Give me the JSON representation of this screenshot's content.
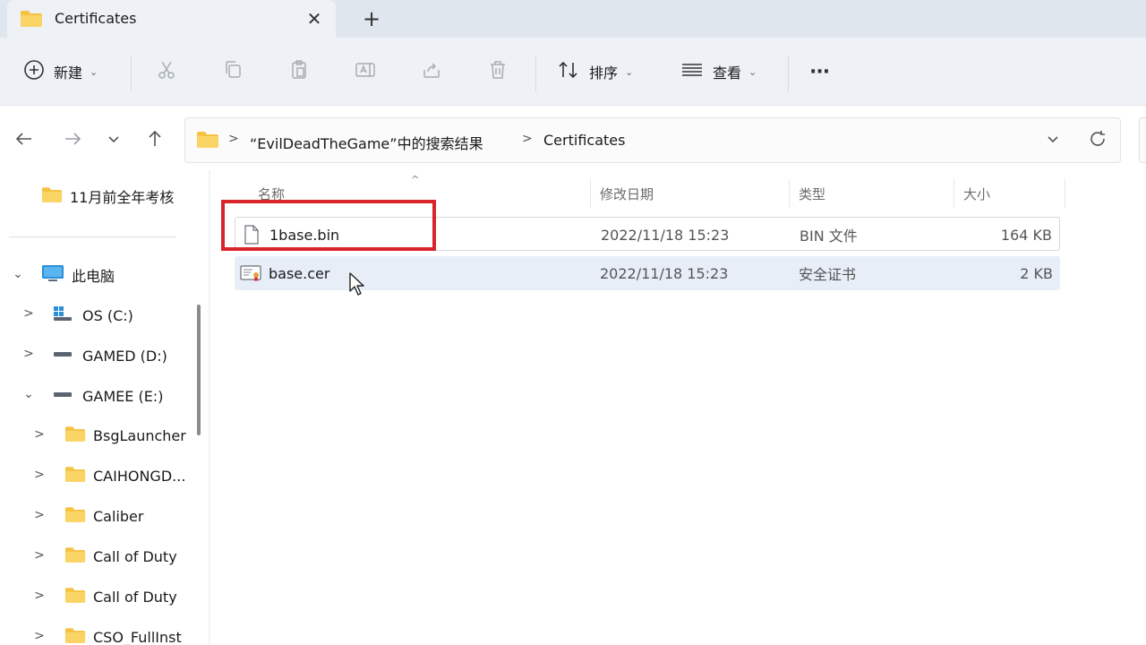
{
  "tab": {
    "title": "Certificates",
    "close": "✕",
    "new_tab": "+"
  },
  "toolbar": {
    "new_label": "新建",
    "sort_label": "排序",
    "view_label": "查看",
    "more": "···"
  },
  "address": {
    "search_results": "“EvilDeadTheGame”中的搜索结果",
    "current": "Certificates"
  },
  "nav": {
    "quick_item": "11月前全年考核",
    "this_pc": "此电脑",
    "drives": [
      "OS (C:)",
      "GAMED (D:)",
      "GAMEE (E:)"
    ],
    "folders": [
      "BsgLauncher",
      "CAIHONGD...",
      "Caliber",
      "Call of Duty",
      "Call of Duty",
      "CSO_FullInst"
    ]
  },
  "columns": {
    "name": "名称",
    "date": "修改日期",
    "type": "类型",
    "size": "大小"
  },
  "files": [
    {
      "name": "1base.bin",
      "date": "2022/11/18 15:23",
      "type": "BIN 文件",
      "size": "164 KB",
      "icon": "file-blank-icon"
    },
    {
      "name": "base.cer",
      "date": "2022/11/18 15:23",
      "type": "安全证书",
      "size": "2 KB",
      "icon": "certificate-icon"
    }
  ],
  "colors": {
    "folder": "#f5c242",
    "highlight": "#d8242b",
    "selection": "#e7eef8"
  }
}
